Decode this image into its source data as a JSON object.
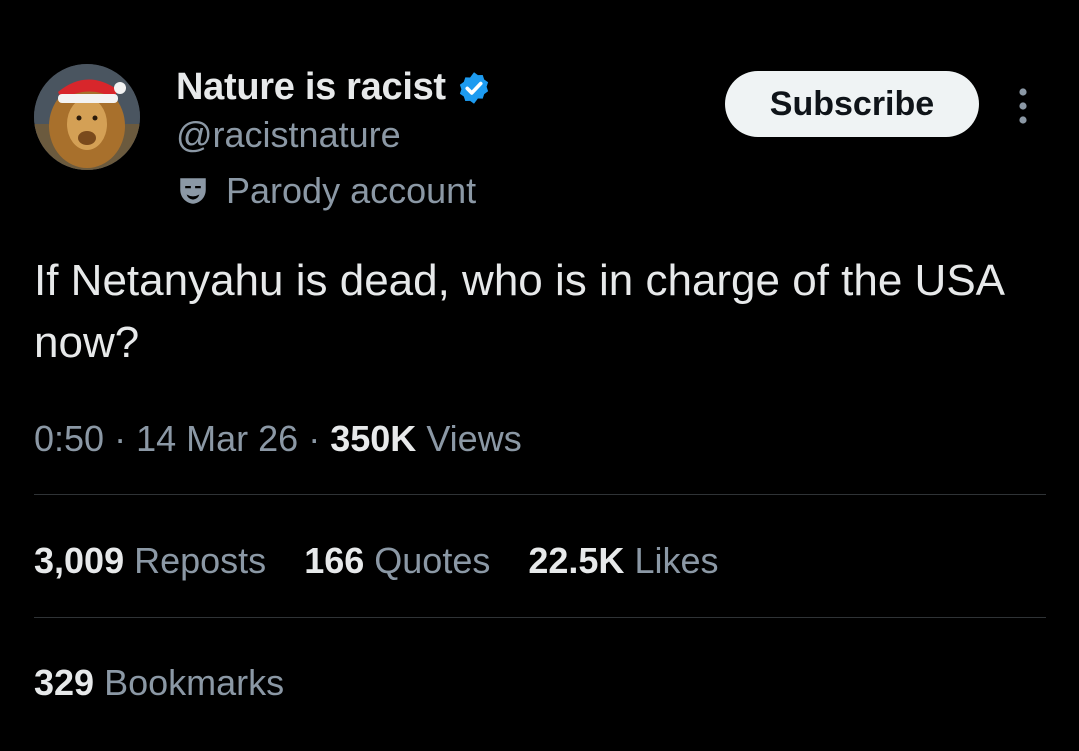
{
  "author": {
    "display_name": "Nature is racist",
    "handle": "@racistnature",
    "parody_label": "Parody account",
    "avatar_icon": "lion-santa-hat-avatar",
    "verified_icon": "verified-badge-icon",
    "verified_color": "#1d9bf0"
  },
  "actions": {
    "subscribe_label": "Subscribe",
    "more_icon": "more-vertical-icon"
  },
  "tweet": {
    "text": "If Netanyahu is dead, who is in charge of the USA now?",
    "time": "0:50",
    "date": "14 Mar 26",
    "separator": "·",
    "views_count": "350K",
    "views_label": "Views"
  },
  "stats": {
    "reposts_count": "3,009",
    "reposts_label": "Reposts",
    "quotes_count": "166",
    "quotes_label": "Quotes",
    "likes_count": "22.5K",
    "likes_label": "Likes",
    "bookmarks_count": "329",
    "bookmarks_label": "Bookmarks"
  },
  "colors": {
    "background": "#000000",
    "primary_text": "#e7e9ea",
    "secondary_text": "#8b98a5",
    "divider": "#2f3336",
    "button_bg": "#eff3f4"
  }
}
